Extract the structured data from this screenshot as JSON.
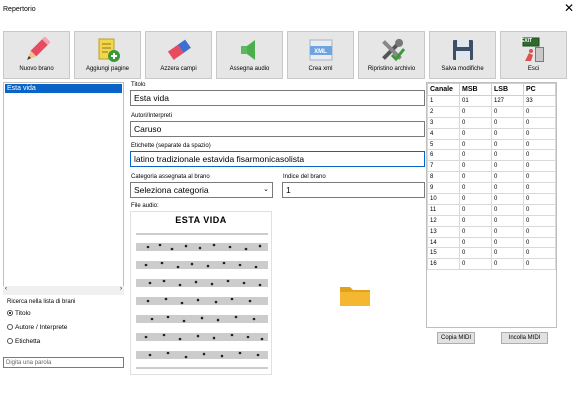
{
  "window": {
    "title": "Repertorio",
    "close_glyph": "✕"
  },
  "toolbar": [
    {
      "label": "Nuovo brano",
      "icon": "pencil-icon"
    },
    {
      "label": "Aggiungi pagine",
      "icon": "add-page-icon"
    },
    {
      "label": "Azzera campi",
      "icon": "eraser-icon"
    },
    {
      "label": "Assegna audio",
      "icon": "speaker-icon"
    },
    {
      "label": "Crea xml",
      "icon": "xml-file-icon",
      "icon_text": "XML"
    },
    {
      "label": "Ripristino archivio",
      "icon": "tools-icon"
    },
    {
      "label": "Salva modifiche",
      "icon": "floppy-disk-icon"
    },
    {
      "label": "Esci",
      "icon": "exit-door-icon",
      "icon_text": "EXIT"
    }
  ],
  "song_list": {
    "items": [
      "Esta vida"
    ],
    "selected": "Esta vida"
  },
  "search_panel": {
    "title": "Ricerca nella lista di brani",
    "options": [
      "Titolo",
      "Autore / Interprete",
      "Etichetta"
    ],
    "selected": "Titolo",
    "placeholder": "Digita una parola"
  },
  "form": {
    "title_label": "Titolo",
    "title_value": "Esta vida",
    "authors_label": "Autori/Interpreti",
    "authors_value": "Caruso",
    "tags_label": "Etichette (separate da spazio)",
    "tags_value": "latino tradizionale estavida fisarmonicasolista",
    "category_label": "Categoria assegnata al brano",
    "category_value": "Seleziona categoria",
    "index_label": "Indice del brano",
    "index_value": "1",
    "audio_label": "File audio:"
  },
  "sheet": {
    "title": "ESTA VIDA"
  },
  "midi": {
    "headers": [
      "Canale",
      "MSB",
      "LSB",
      "PC"
    ],
    "rows": [
      [
        "1",
        "01",
        "127",
        "33"
      ],
      [
        "2",
        "0",
        "0",
        "0"
      ],
      [
        "3",
        "0",
        "0",
        "0"
      ],
      [
        "4",
        "0",
        "0",
        "0"
      ],
      [
        "5",
        "0",
        "0",
        "0"
      ],
      [
        "6",
        "0",
        "0",
        "0"
      ],
      [
        "7",
        "0",
        "0",
        "0"
      ],
      [
        "8",
        "0",
        "0",
        "0"
      ],
      [
        "9",
        "0",
        "0",
        "0"
      ],
      [
        "10",
        "0",
        "0",
        "0"
      ],
      [
        "11",
        "0",
        "0",
        "0"
      ],
      [
        "12",
        "0",
        "0",
        "0"
      ],
      [
        "13",
        "0",
        "0",
        "0"
      ],
      [
        "14",
        "0",
        "0",
        "0"
      ],
      [
        "15",
        "0",
        "0",
        "0"
      ],
      [
        "16",
        "0",
        "0",
        "0"
      ]
    ],
    "copy_label": "Copia MIDI",
    "paste_label": "Incolla MIDI"
  },
  "colors": {
    "selection": "#0a64c8",
    "folder": "#f5b731"
  }
}
